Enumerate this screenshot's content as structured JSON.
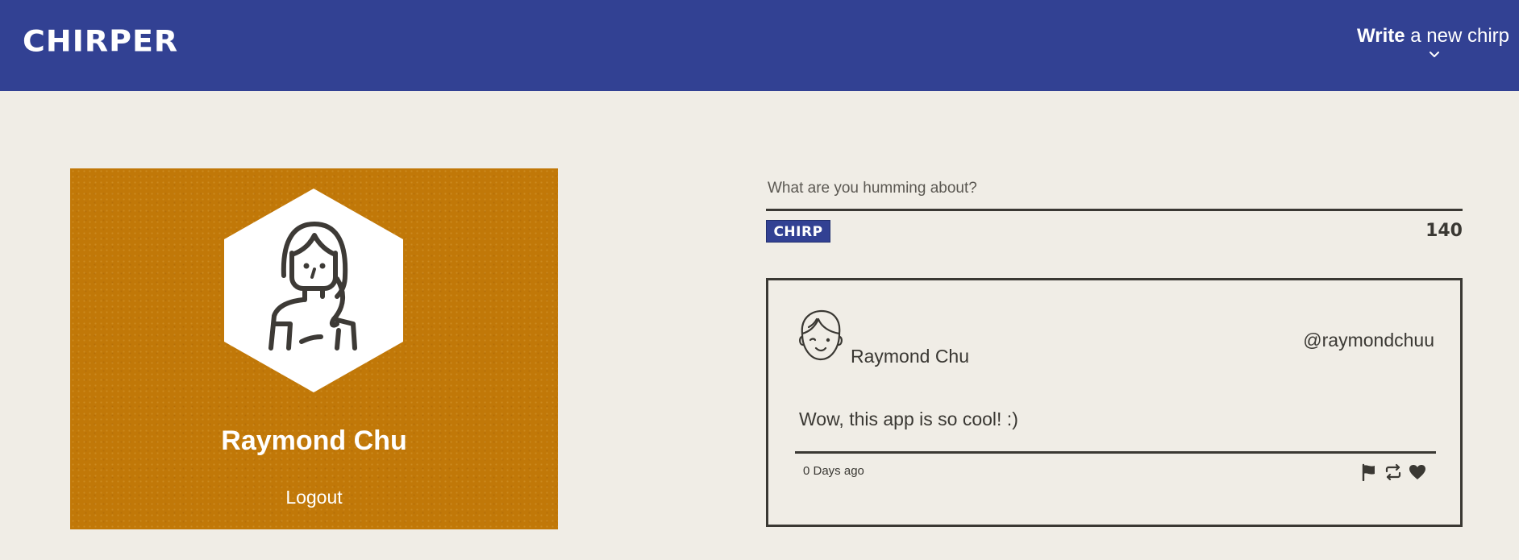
{
  "header": {
    "logo": "CHIRPER",
    "write_bold": "Write",
    "write_rest": " a new chirp"
  },
  "profile": {
    "name": "Raymond Chu",
    "logout_label": "Logout",
    "avatar_icon": "woman-avatar-icon"
  },
  "composer": {
    "placeholder": "What are you humming about?",
    "value": "",
    "chirp_button_label": "CHIRP",
    "char_count": "140"
  },
  "chirps": [
    {
      "author": "Raymond Chu",
      "handle": "@raymondchuu",
      "text": "Wow, this app is so cool! :)",
      "time": "0 Days ago",
      "avatar_icon": "man-avatar-icon",
      "actions": [
        "flag-icon",
        "rechirp-icon",
        "heart-icon"
      ]
    }
  ],
  "colors": {
    "header_bg": "#324193",
    "page_bg": "#f0ede6",
    "profile_bg": "#c17808",
    "text": "#3a3833"
  }
}
